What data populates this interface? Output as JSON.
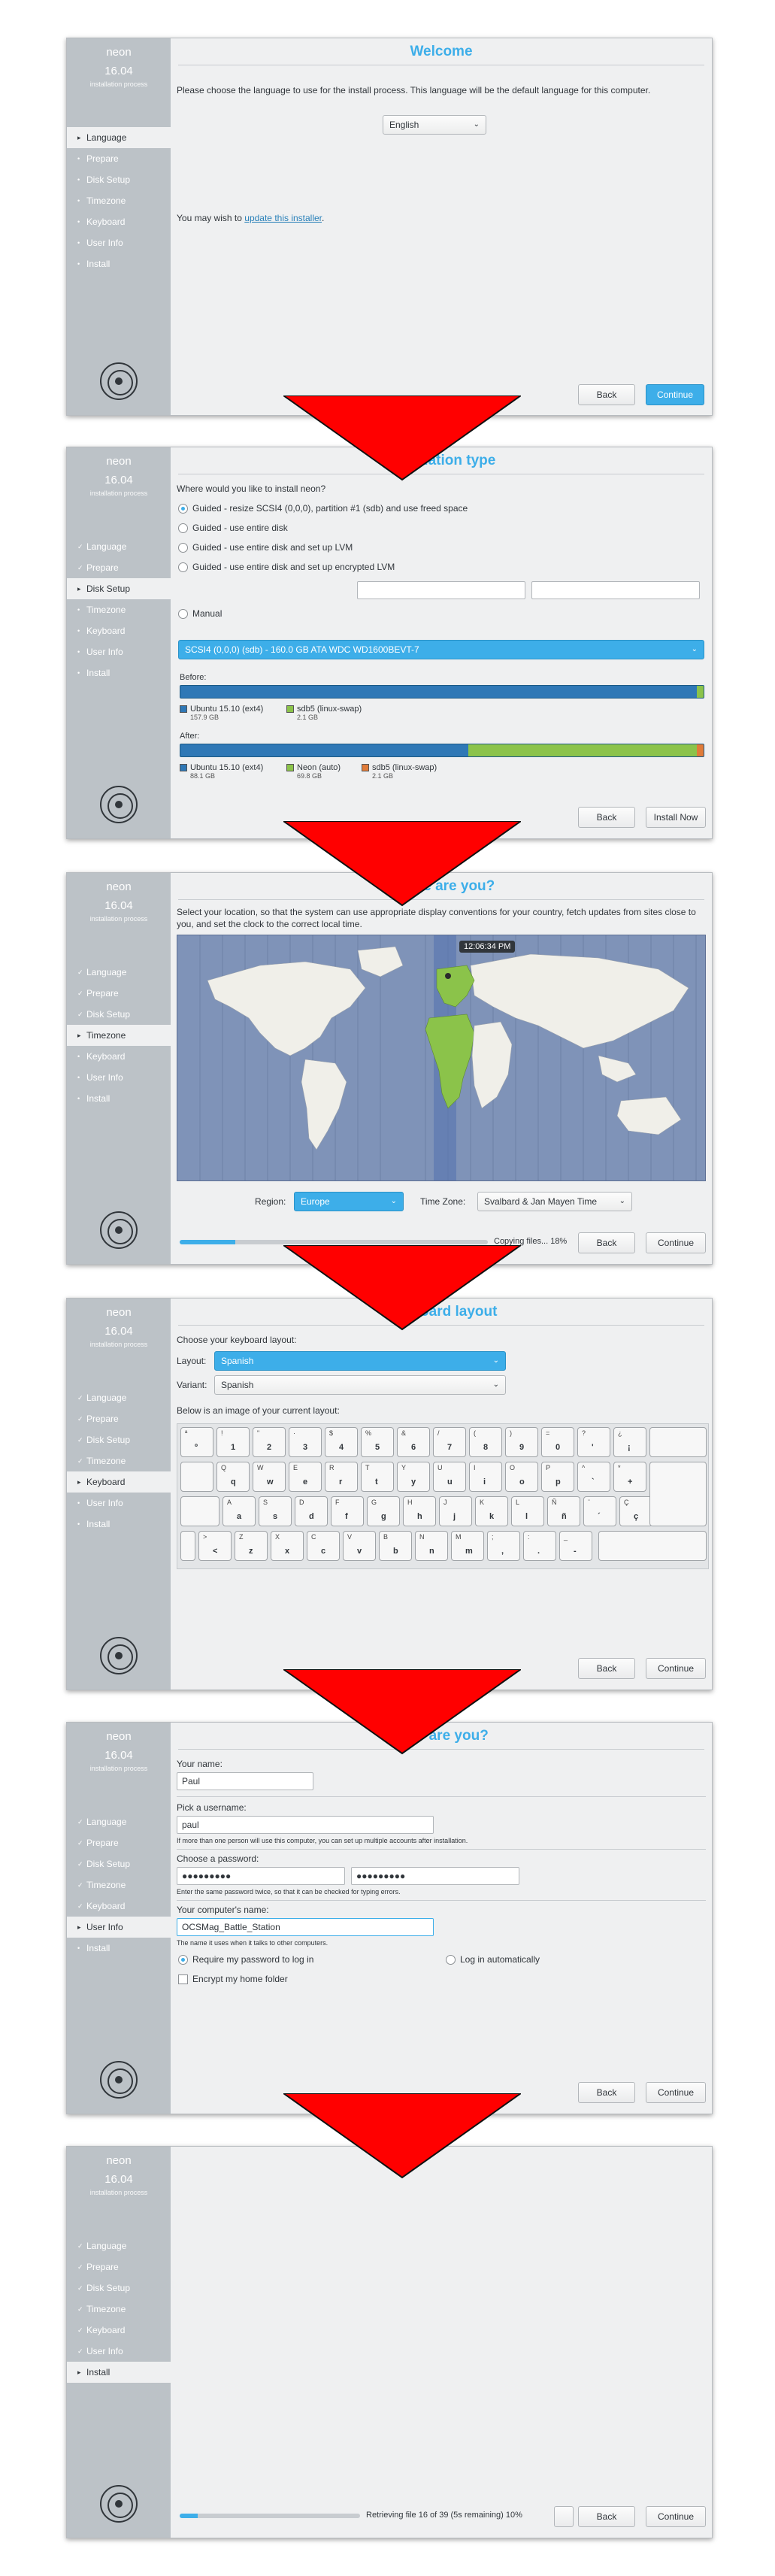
{
  "brand": {
    "name": "neon",
    "version": "16.04",
    "sub": "installation process"
  },
  "steps": [
    "Language",
    "Prepare",
    "Disk Setup",
    "Timezone",
    "Keyboard",
    "User Info",
    "Install"
  ],
  "buttons": {
    "back": "Back",
    "continue": "Continue",
    "install_now": "Install Now"
  },
  "welcome": {
    "title": "Welcome",
    "intro": "Please choose the language to use for the install process. This language will be the default language for this computer.",
    "language": "English",
    "update_prefix": "You may wish to ",
    "update_link": "update this installer",
    "update_suffix": "."
  },
  "install_type": {
    "title": "Installation type",
    "question": "Where would you like to install neon?",
    "options": [
      "Guided - resize SCSI4 (0,0,0), partition #1 (sdb) and use freed space",
      "Guided - use entire disk",
      "Guided - use entire disk and set up LVM",
      "Guided - use entire disk and set up encrypted LVM"
    ],
    "manual": "Manual",
    "disk": "SCSI4 (0,0,0) (sdb) - 160.0 GB ATA WDC WD1600BEVT-7",
    "before_label": "Before:",
    "after_label": "After:",
    "before": [
      {
        "name": "Ubuntu 15.10 (ext4)",
        "size": "157.9 GB",
        "color": "#2f78b6"
      },
      {
        "name": "sdb5 (linux-swap)",
        "size": "2.1 GB",
        "color": "#8bc34a"
      }
    ],
    "after": [
      {
        "name": "Ubuntu 15.10 (ext4)",
        "size": "88.1 GB",
        "color": "#2f78b6"
      },
      {
        "name": "Neon (auto)",
        "size": "69.8 GB",
        "color": "#8bc34a"
      },
      {
        "name": "sdb5 (linux-swap)",
        "size": "2.1 GB",
        "color": "#e07b39"
      }
    ]
  },
  "timezone": {
    "title": "Where are you?",
    "intro": "Select your location, so that the system can use appropriate display conventions for your country, fetch updates from sites close to you, and set the clock to the correct local time.",
    "time": "12:06:34 PM",
    "region_label": "Region:",
    "region": "Europe",
    "zone_label": "Time Zone:",
    "zone": "Svalbard & Jan Mayen Time",
    "status": "Copying files... 18%",
    "progress": 0.18
  },
  "keyboard": {
    "title": "Keyboard layout",
    "choose": "Choose your keyboard layout:",
    "layout_label": "Layout:",
    "layout": "Spanish",
    "variant_label": "Variant:",
    "variant": "Spanish",
    "image_label": "Below is an image of your current layout:",
    "rows": [
      [
        [
          "ª",
          "º"
        ],
        [
          "!",
          "1"
        ],
        [
          "\"",
          "2"
        ],
        [
          "·",
          "3"
        ],
        [
          "$",
          "4"
        ],
        [
          "%",
          "5"
        ],
        [
          "&",
          "6"
        ],
        [
          "/",
          "7"
        ],
        [
          "(",
          "8"
        ],
        [
          ")",
          "9"
        ],
        [
          "=",
          "0"
        ],
        [
          "?",
          "'"
        ],
        [
          "¿",
          "¡"
        ]
      ],
      [
        [
          "Q",
          "q"
        ],
        [
          "W",
          "w"
        ],
        [
          "E",
          "e"
        ],
        [
          "R",
          "r"
        ],
        [
          "T",
          "t"
        ],
        [
          "Y",
          "y"
        ],
        [
          "U",
          "u"
        ],
        [
          "I",
          "i"
        ],
        [
          "O",
          "o"
        ],
        [
          "P",
          "p"
        ],
        [
          "^",
          "`"
        ],
        [
          "*",
          "+"
        ]
      ],
      [
        [
          "A",
          "a"
        ],
        [
          "S",
          "s"
        ],
        [
          "D",
          "d"
        ],
        [
          "F",
          "f"
        ],
        [
          "G",
          "g"
        ],
        [
          "H",
          "h"
        ],
        [
          "J",
          "j"
        ],
        [
          "K",
          "k"
        ],
        [
          "L",
          "l"
        ],
        [
          "Ñ",
          "ñ"
        ],
        [
          "¨",
          "´"
        ],
        [
          "Ç",
          "ç"
        ]
      ],
      [
        [
          ">",
          "<"
        ],
        [
          "Z",
          "z"
        ],
        [
          "X",
          "x"
        ],
        [
          "C",
          "c"
        ],
        [
          "V",
          "v"
        ],
        [
          "B",
          "b"
        ],
        [
          "N",
          "n"
        ],
        [
          "M",
          "m"
        ],
        [
          ";",
          ","
        ],
        [
          ":",
          "."
        ],
        [
          "_",
          "-"
        ]
      ]
    ]
  },
  "users": {
    "title": "Who are you?",
    "name_label": "Your name:",
    "name": "Paul",
    "username_label": "Pick a username:",
    "username": "paul",
    "username_hint": "If more than one person will use this computer, you can set up multiple accounts after installation.",
    "password_label": "Choose a password:",
    "password": "●●●●●●●●●",
    "password2": "●●●●●●●●●",
    "password_hint": "Enter the same password twice, so that it can be checked for typing errors.",
    "computer_label": "Your computer's name:",
    "computer": "OCSMag_Battle_Station",
    "computer_hint": "The name it uses when it talks to other computers.",
    "require_pw": "Require my password to log in",
    "auto_login": "Log in automatically",
    "encrypt": "Encrypt my home folder"
  },
  "install": {
    "status": "Retrieving file 16 of 39 (5s remaining) 10%",
    "progress": 0.1
  }
}
